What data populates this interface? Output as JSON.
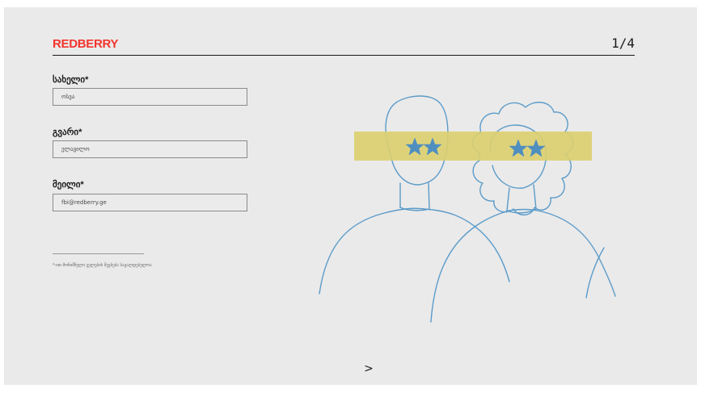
{
  "header": {
    "logo": "REDBERRY",
    "step": "1/4"
  },
  "form": {
    "fields": [
      {
        "label": "სახელი*",
        "value": "ოსვა"
      },
      {
        "label": "გვარი*",
        "value": "ელავილო"
      },
      {
        "label": "მეილი*",
        "value": "fbi@redberry.ge"
      }
    ],
    "note": "*-ით მონიშნული ველების შევსება სავალდებულოა"
  },
  "nav": {
    "next_icon": "chevron-right-icon",
    "next_glyph": ">"
  },
  "colors": {
    "brand": "#f2342e",
    "background": "#eaeaea",
    "line_art": "#5b9bc9",
    "highlight": "#dccf6e"
  }
}
